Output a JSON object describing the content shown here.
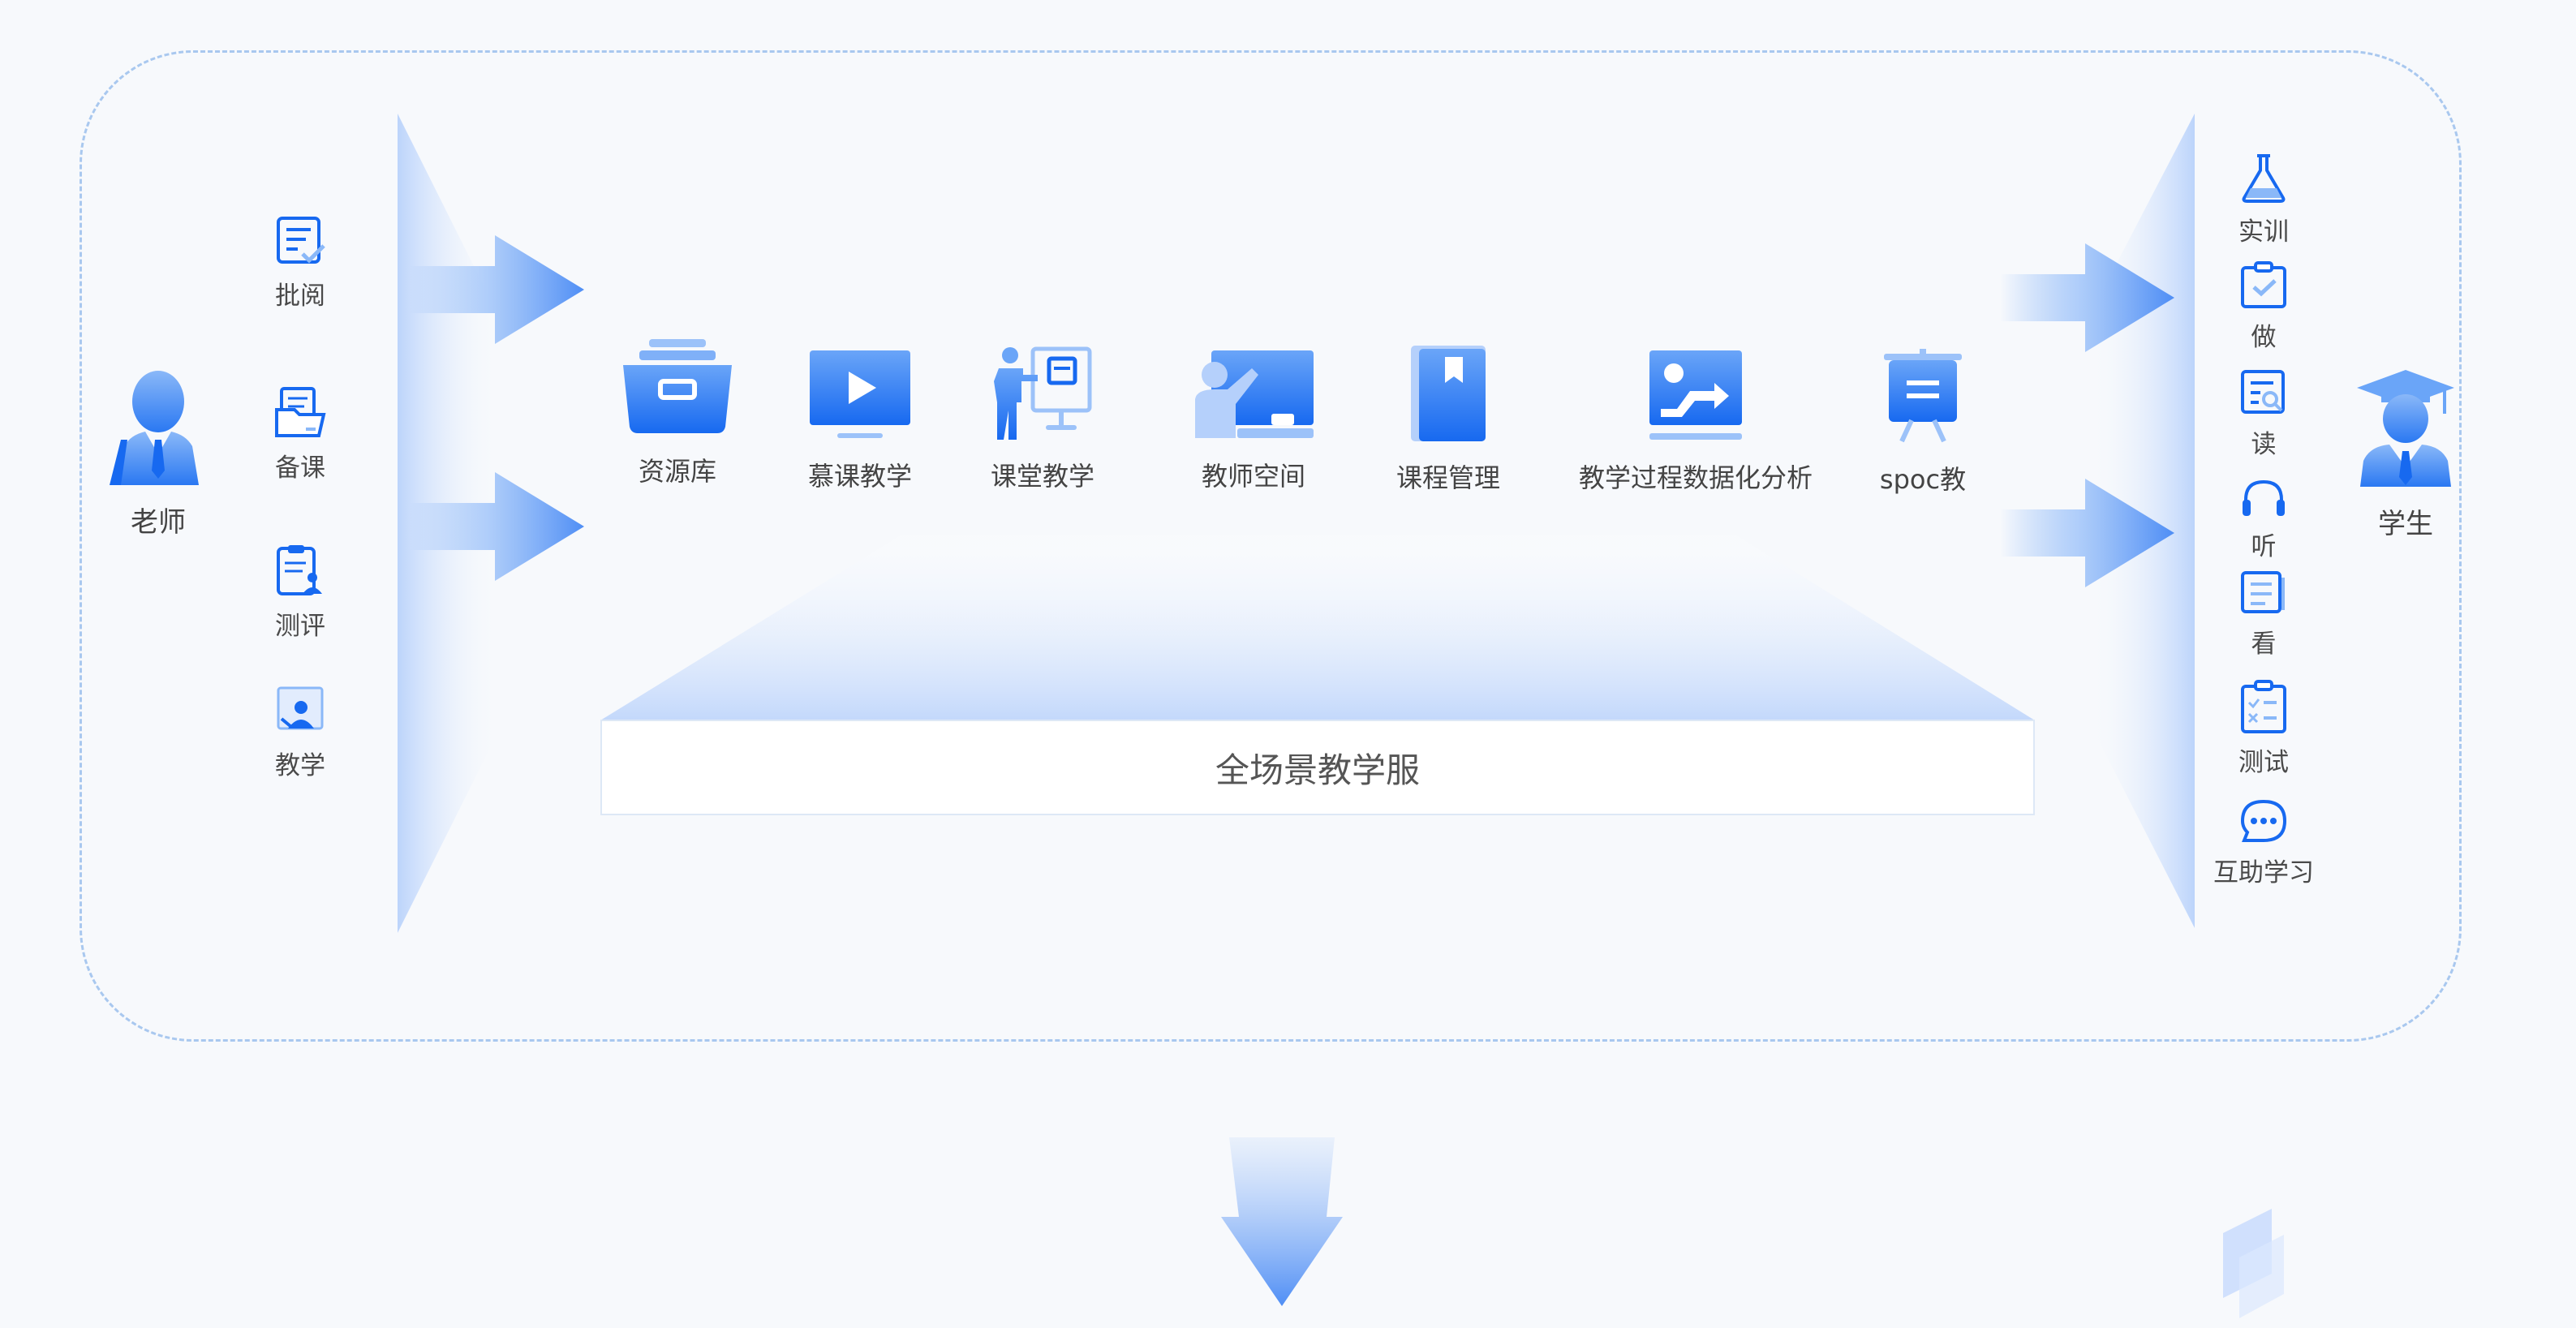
{
  "colors": {
    "accent": "#1769f0",
    "accent_light": "#5b9af7",
    "soft": "#cddfff",
    "frame": "#a9c8ef",
    "background": "#f7f9fc"
  },
  "teacher": {
    "label": "老师",
    "icon": "teacher-icon",
    "actions": [
      {
        "label": "批阅",
        "icon": "review-icon"
      },
      {
        "label": "备课",
        "icon": "lesson-prep-icon"
      },
      {
        "label": "测评",
        "icon": "assessment-icon"
      },
      {
        "label": "教学",
        "icon": "teaching-icon"
      }
    ]
  },
  "services": [
    {
      "label": "资源库",
      "icon": "resource-box-icon"
    },
    {
      "label": "慕课教学",
      "icon": "play-video-icon"
    },
    {
      "label": "课堂教学",
      "icon": "presenter-icon"
    },
    {
      "label": "教师空间",
      "icon": "teacher-desk-icon"
    },
    {
      "label": "课程管理",
      "icon": "bookmark-book-icon"
    },
    {
      "label": "教学过程数据化分析",
      "icon": "data-analysis-icon"
    },
    {
      "label": "spoc教",
      "icon": "easel-icon"
    }
  ],
  "platform": {
    "label": "全场景教学服"
  },
  "student": {
    "label": "学生",
    "icon": "student-icon",
    "activities": [
      {
        "label": "实训",
        "icon": "flask-icon"
      },
      {
        "label": "做",
        "icon": "clipboard-check-icon"
      },
      {
        "label": "读",
        "icon": "document-search-icon"
      },
      {
        "label": "听",
        "icon": "headphones-icon"
      },
      {
        "label": "看",
        "icon": "document-icon"
      },
      {
        "label": "测试",
        "icon": "checklist-icon"
      },
      {
        "label": "互助学习",
        "icon": "chat-bubble-icon"
      }
    ]
  }
}
